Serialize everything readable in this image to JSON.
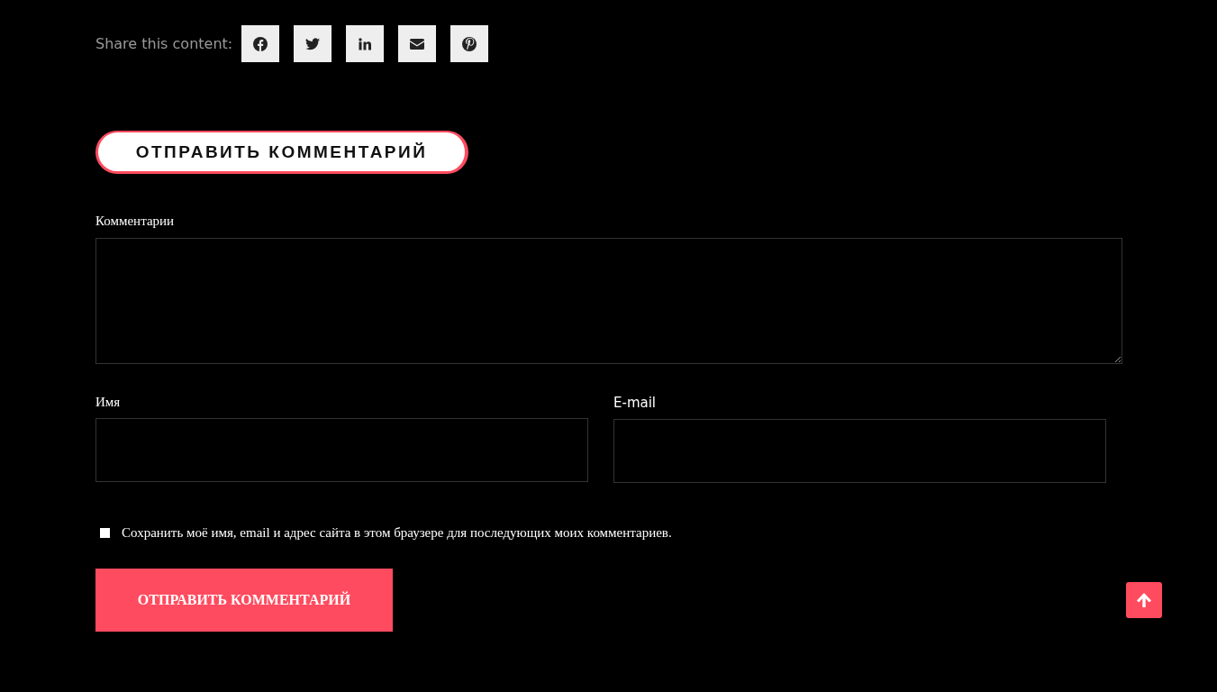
{
  "share": {
    "label": "Share this content:",
    "buttons": [
      {
        "kind": "facebook"
      },
      {
        "kind": "twitter"
      },
      {
        "kind": "linkedin"
      },
      {
        "kind": "email"
      },
      {
        "kind": "pinterest"
      }
    ]
  },
  "heading": "ОТПРАВИТЬ КОММЕНТАРИЙ",
  "form": {
    "comment_label": "Комментарии",
    "name_label": "Имя",
    "email_label": "E-mail",
    "remember": {
      "label": "Сохранить моё имя, email и адрес сайта в этом браузере для последующих моих комментариев.",
      "checked": false
    },
    "submit": "ОТПРАВИТЬ КОММЕНТАРИЙ"
  }
}
